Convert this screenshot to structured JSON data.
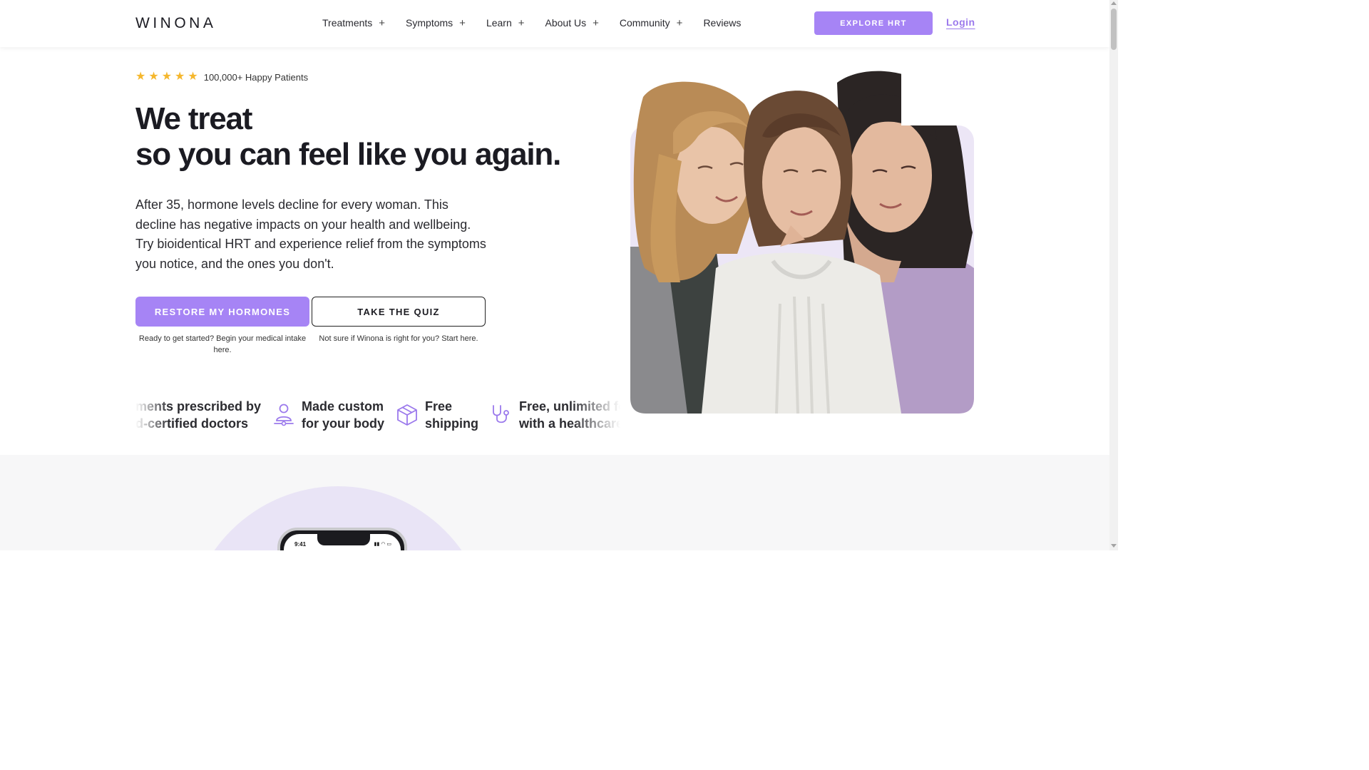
{
  "header": {
    "brand": "WINONA",
    "nav": [
      {
        "label": "Treatments",
        "expand": "+"
      },
      {
        "label": "Symptoms",
        "expand": "+"
      },
      {
        "label": "Learn",
        "expand": "+"
      },
      {
        "label": "About Us",
        "expand": "+"
      },
      {
        "label": "Community",
        "expand": "+"
      },
      {
        "label": "Reviews",
        "expand": ""
      }
    ],
    "cta": "EXPLORE HRT",
    "login": "Login"
  },
  "hero": {
    "rating": {
      "stars": 5,
      "text": "100,000+ Happy Patients"
    },
    "headline_line1": "We treat",
    "headline_line2": "so you can feel like you again.",
    "intro": "After 35, hormone levels decline for every woman. This decline has negative impacts on your health and wellbeing. Try bioidentical HRT and experience relief from the symptoms you notice, and the ones you don't.",
    "primary_button": "RESTORE MY HORMONES",
    "primary_caption": "Ready to get started? Begin your medical intake here.",
    "secondary_button": "TAKE THE QUIZ",
    "secondary_caption": "Not sure if Winona is right for you? Start here."
  },
  "features": [
    {
      "icon": "doctor-icon",
      "line1": "ments prescribed by",
      "line2": "d-certified doctors"
    },
    {
      "icon": "person-icon",
      "line1": "Made custom",
      "line2": "for your body"
    },
    {
      "icon": "box-icon",
      "line1": "Free",
      "line2": "shipping"
    },
    {
      "icon": "stethoscope-icon",
      "line1": "Free, unlimited fo",
      "line2": "with a healthcare"
    }
  ],
  "phone": {
    "time": "9:41"
  },
  "colors": {
    "accent": "#a684f5",
    "star": "#f5b72d",
    "lavender": "#e9e4f6"
  }
}
